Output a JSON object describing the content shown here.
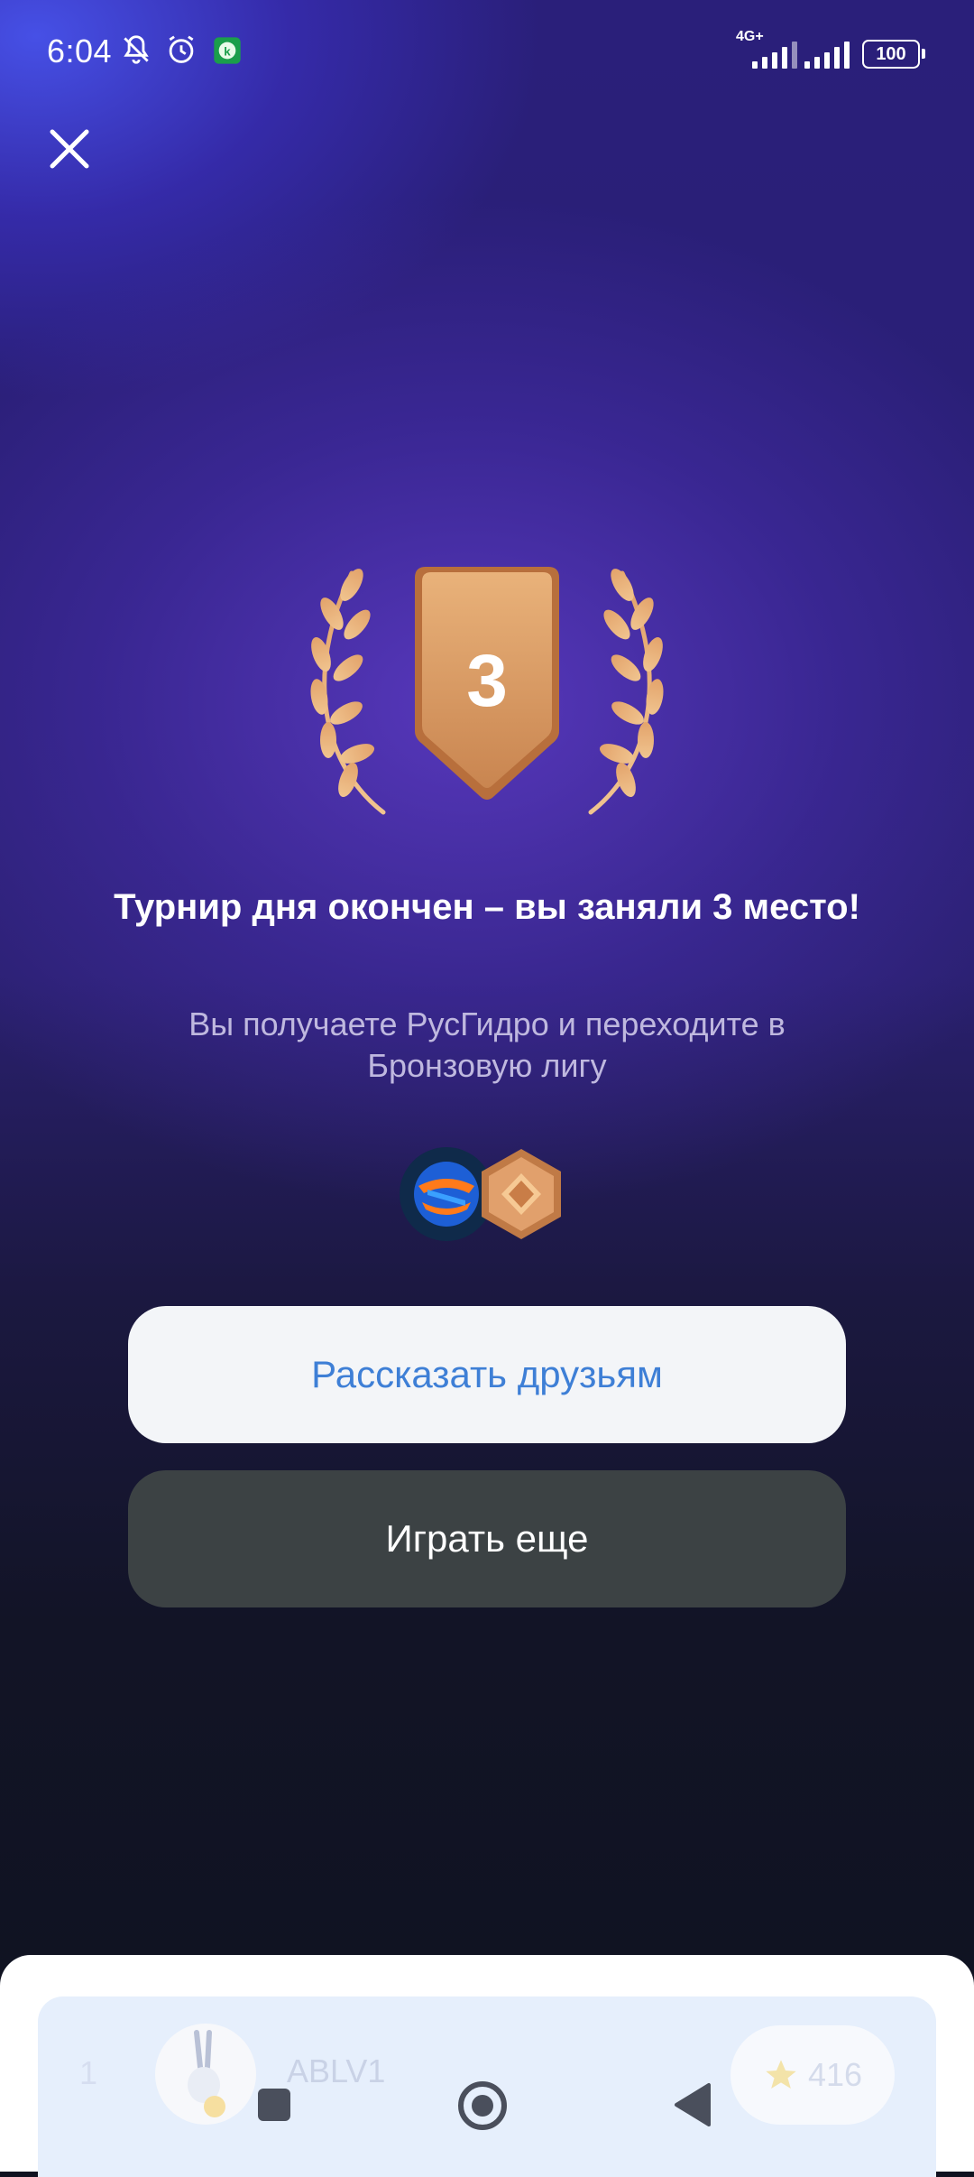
{
  "status_bar": {
    "time": "6:04",
    "network": "4G+",
    "battery": "100",
    "icons": [
      "bell-muted-icon",
      "alarm-icon",
      "app-k-icon",
      "signal-icon",
      "signal-icon",
      "battery-icon"
    ]
  },
  "close_icon": "close-icon",
  "medal": {
    "place": "3",
    "color": "#e0a06a"
  },
  "title": "Турнир дня окончен – вы заняли 3 место!",
  "subtitle": "Вы получаете РусГидро и переходите в Бронзовую лигу",
  "rewards": [
    "company-logo-icon",
    "bronze-league-icon"
  ],
  "buttons": {
    "share": "Рассказать друзьям",
    "play_again": "Играть еще"
  },
  "leaderboard_row": {
    "rank": "1",
    "name": "ABLV1",
    "score": "416",
    "score_icon": "star-icon"
  },
  "navbar": {
    "icons": [
      "recents-square-icon",
      "home-circle-icon",
      "back-triangle-icon"
    ]
  },
  "colors": {
    "accent": "#3e7fd6",
    "bronze": "#e0a06a",
    "play_button": "#3c4244",
    "share_button": "#f3f5f8"
  }
}
